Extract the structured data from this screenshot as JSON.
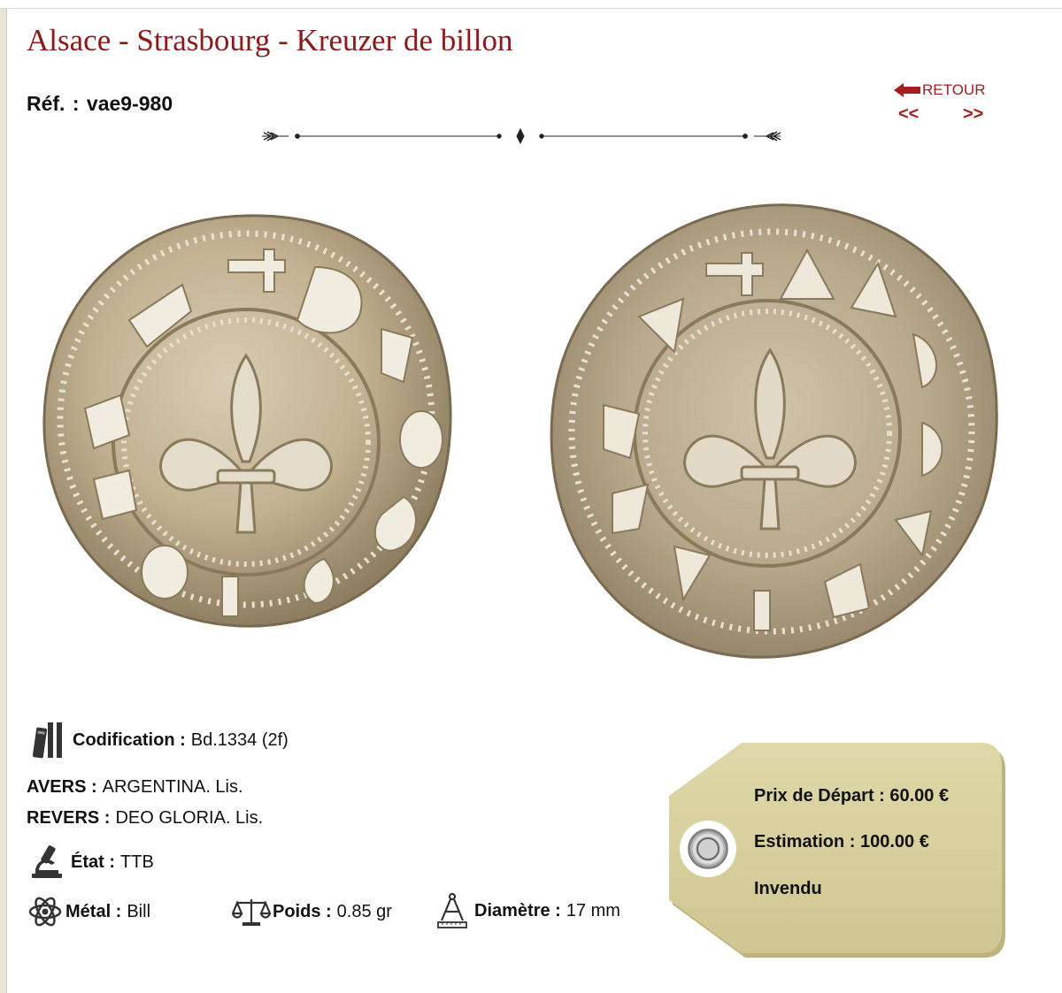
{
  "page": {
    "title": "Alsace - Strasbourg - Kreuzer de billon",
    "ref_label": "Réf.",
    "ref_value": "vae9-980"
  },
  "nav": {
    "back_label": "RETOUR",
    "prev_label": "<<",
    "next_label": ">>"
  },
  "details": {
    "codification_label": "Codification",
    "codification_value": "Bd.1334 (2f)",
    "avers_label": "AVERS",
    "avers_value": "ARGENTINA. Lis.",
    "revers_label": "REVERS",
    "revers_value": "DEO GLORIA. Lis.",
    "etat_label": "État",
    "etat_value": "TTB",
    "metal_label": "Métal",
    "metal_value": "Bill",
    "poids_label": "Poids",
    "poids_value": "0.85 gr",
    "diametre_label": "Diamètre",
    "diametre_value": "17 mm"
  },
  "price_tag": {
    "prix_depart": "Prix de Départ : 60.00 €",
    "estimation": "Estimation : 100.00 €",
    "status": "Invendu"
  },
  "colors": {
    "title": "#8b1a1a",
    "nav": "#a32020",
    "tag": "#d7cf9d"
  },
  "icons": {
    "back": "arrow-left-icon",
    "codification": "books-icon",
    "etat": "microscope-icon",
    "metal": "atom-icon",
    "poids": "scale-icon",
    "diametre": "compass-icon"
  }
}
